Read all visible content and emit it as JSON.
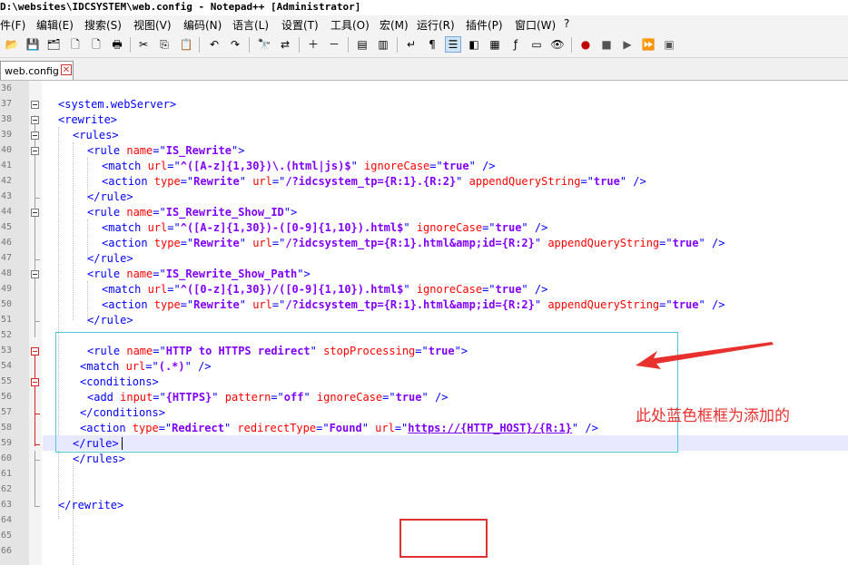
{
  "window": {
    "title": "D:\\websites\\IDCSYSTEM\\web.config - Notepad++ [Administrator]"
  },
  "menu": [
    "件(F)",
    "编辑(E)",
    "搜索(S)",
    "视图(V)",
    "编码(N)",
    "语言(L)",
    "设置(T)",
    "工具(O)",
    "宏(M)",
    "运行(R)",
    "插件(P)",
    "窗口(W)",
    "?"
  ],
  "toolbar": [
    {
      "name": "open-file-icon",
      "glyph": "📂"
    },
    {
      "name": "save-icon",
      "glyph": "💾"
    },
    {
      "name": "save-all-icon",
      "glyph": "🗂"
    },
    {
      "name": "close-file-icon",
      "glyph": "🗋"
    },
    {
      "name": "close-all-icon",
      "glyph": "🗋"
    },
    {
      "name": "print-icon",
      "glyph": "🖶"
    },
    {
      "name": "cut-icon",
      "glyph": "✂"
    },
    {
      "name": "copy-icon",
      "glyph": "⎘"
    },
    {
      "name": "paste-icon",
      "glyph": "📋"
    },
    {
      "name": "undo-icon",
      "glyph": "↶"
    },
    {
      "name": "redo-icon",
      "glyph": "↷"
    },
    {
      "name": "find-icon",
      "glyph": "🔭"
    },
    {
      "name": "replace-icon",
      "glyph": "⇄"
    },
    {
      "name": "zoom-in-icon",
      "glyph": "＋"
    },
    {
      "name": "zoom-out-icon",
      "glyph": "－"
    },
    {
      "name": "sync-vertical-icon",
      "glyph": "▤"
    },
    {
      "name": "sync-horizontal-icon",
      "glyph": "▥"
    },
    {
      "name": "word-wrap-icon",
      "glyph": "↵"
    },
    {
      "name": "show-all-chars-icon",
      "glyph": "¶"
    },
    {
      "name": "indent-guide-icon",
      "glyph": "☰"
    },
    {
      "name": "user-language-icon",
      "glyph": "◧"
    },
    {
      "name": "doc-map-icon",
      "glyph": "▦"
    },
    {
      "name": "function-list-icon",
      "glyph": "ƒ"
    },
    {
      "name": "folder-workspace-icon",
      "glyph": "▭"
    },
    {
      "name": "monitoring-icon",
      "glyph": "👁"
    },
    {
      "name": "record-macro-icon",
      "glyph": "●"
    },
    {
      "name": "stop-macro-icon",
      "glyph": "■"
    },
    {
      "name": "play-macro-icon",
      "glyph": "▶"
    },
    {
      "name": "run-macro-multiple-icon",
      "glyph": "⏩"
    },
    {
      "name": "save-macro-icon",
      "glyph": "▣"
    }
  ],
  "tab": {
    "label": "web.config",
    "close": "✕"
  },
  "editor": {
    "line_numbers": [
      "36",
      "37",
      "38",
      "39",
      "40",
      "41",
      "42",
      "43",
      "44",
      "45",
      "46",
      "47",
      "48",
      "49",
      "50",
      "51",
      "52",
      "53",
      "54",
      "55",
      "56",
      "57",
      "58",
      "59",
      "60",
      "61",
      "62",
      "63",
      "64",
      "65",
      "66"
    ],
    "lines": [
      [],
      [
        {
          "c": "t",
          "s": "<system.webServer>"
        }
      ],
      [
        {
          "c": "t",
          "s": "<rewrite>"
        }
      ],
      [
        {
          "c": "t",
          "s": "<rules>"
        }
      ],
      [
        {
          "c": "t",
          "s": "<rule "
        },
        {
          "c": "a",
          "s": "name"
        },
        {
          "c": "t",
          "s": "=\""
        },
        {
          "c": "v",
          "s": "IS_Rewrite"
        },
        {
          "c": "t",
          "s": "\">"
        }
      ],
      [
        {
          "c": "t",
          "s": "<match "
        },
        {
          "c": "a",
          "s": "url"
        },
        {
          "c": "t",
          "s": "=\""
        },
        {
          "c": "v",
          "s": "^([A-z]{1,30})\\.(html|js)$"
        },
        {
          "c": "t",
          "s": "\" "
        },
        {
          "c": "a",
          "s": "ignoreCase"
        },
        {
          "c": "t",
          "s": "=\""
        },
        {
          "c": "v",
          "s": "true"
        },
        {
          "c": "t",
          "s": "\" />"
        }
      ],
      [
        {
          "c": "t",
          "s": "<action "
        },
        {
          "c": "a",
          "s": "type"
        },
        {
          "c": "t",
          "s": "=\""
        },
        {
          "c": "v",
          "s": "Rewrite"
        },
        {
          "c": "t",
          "s": "\" "
        },
        {
          "c": "a",
          "s": "url"
        },
        {
          "c": "t",
          "s": "=\""
        },
        {
          "c": "v",
          "s": "/?idcsystem_tp={R:1}.{R:2}"
        },
        {
          "c": "t",
          "s": "\" "
        },
        {
          "c": "a",
          "s": "appendQueryString"
        },
        {
          "c": "t",
          "s": "=\""
        },
        {
          "c": "v",
          "s": "true"
        },
        {
          "c": "t",
          "s": "\" />"
        }
      ],
      [
        {
          "c": "t",
          "s": "</rule>"
        }
      ],
      [
        {
          "c": "t",
          "s": "<rule "
        },
        {
          "c": "a",
          "s": "name"
        },
        {
          "c": "t",
          "s": "=\""
        },
        {
          "c": "v",
          "s": "IS_Rewrite_Show_ID"
        },
        {
          "c": "t",
          "s": "\">"
        }
      ],
      [
        {
          "c": "t",
          "s": "<match "
        },
        {
          "c": "a",
          "s": "url"
        },
        {
          "c": "t",
          "s": "=\""
        },
        {
          "c": "v",
          "s": "^([A-z]{1,30})-([0-9]{1,10}).html$"
        },
        {
          "c": "t",
          "s": "\" "
        },
        {
          "c": "a",
          "s": "ignoreCase"
        },
        {
          "c": "t",
          "s": "=\""
        },
        {
          "c": "v",
          "s": "true"
        },
        {
          "c": "t",
          "s": "\" />"
        }
      ],
      [
        {
          "c": "t",
          "s": "<action "
        },
        {
          "c": "a",
          "s": "type"
        },
        {
          "c": "t",
          "s": "=\""
        },
        {
          "c": "v",
          "s": "Rewrite"
        },
        {
          "c": "t",
          "s": "\" "
        },
        {
          "c": "a",
          "s": "url"
        },
        {
          "c": "t",
          "s": "=\""
        },
        {
          "c": "v",
          "s": "/?idcsystem_tp={R:1}.html&amp;id={R:2}"
        },
        {
          "c": "t",
          "s": "\" "
        },
        {
          "c": "a",
          "s": "appendQueryString"
        },
        {
          "c": "t",
          "s": "=\""
        },
        {
          "c": "v",
          "s": "true"
        },
        {
          "c": "t",
          "s": "\" />"
        }
      ],
      [
        {
          "c": "t",
          "s": "</rule>"
        }
      ],
      [
        {
          "c": "t",
          "s": "<rule "
        },
        {
          "c": "a",
          "s": "name"
        },
        {
          "c": "t",
          "s": "=\""
        },
        {
          "c": "v",
          "s": "IS_Rewrite_Show_Path"
        },
        {
          "c": "t",
          "s": "\">"
        }
      ],
      [
        {
          "c": "t",
          "s": "<match "
        },
        {
          "c": "a",
          "s": "url"
        },
        {
          "c": "t",
          "s": "=\""
        },
        {
          "c": "v",
          "s": "^([0-z]{1,30})/([0-9]{1,10}).html$"
        },
        {
          "c": "t",
          "s": "\" "
        },
        {
          "c": "a",
          "s": "ignoreCase"
        },
        {
          "c": "t",
          "s": "=\""
        },
        {
          "c": "v",
          "s": "true"
        },
        {
          "c": "t",
          "s": "\" />"
        }
      ],
      [
        {
          "c": "t",
          "s": "<action "
        },
        {
          "c": "a",
          "s": "type"
        },
        {
          "c": "t",
          "s": "=\""
        },
        {
          "c": "v",
          "s": "Rewrite"
        },
        {
          "c": "t",
          "s": "\" "
        },
        {
          "c": "a",
          "s": "url"
        },
        {
          "c": "t",
          "s": "=\""
        },
        {
          "c": "v",
          "s": "/?idcsystem_tp={R:1}.html&amp;id={R:2}"
        },
        {
          "c": "t",
          "s": "\" "
        },
        {
          "c": "a",
          "s": "appendQueryString"
        },
        {
          "c": "t",
          "s": "=\""
        },
        {
          "c": "v",
          "s": "true"
        },
        {
          "c": "t",
          "s": "\" />"
        }
      ],
      [
        {
          "c": "t",
          "s": "</rule>"
        }
      ],
      [],
      [
        {
          "c": "t",
          "s": "<rule "
        },
        {
          "c": "a",
          "s": "name"
        },
        {
          "c": "t",
          "s": "=\""
        },
        {
          "c": "v",
          "s": "HTTP to HTTPS redirect"
        },
        {
          "c": "t",
          "s": "\" "
        },
        {
          "c": "a",
          "s": "stopProcessing"
        },
        {
          "c": "t",
          "s": "=\""
        },
        {
          "c": "v",
          "s": "true"
        },
        {
          "c": "t",
          "s": "\">"
        }
      ],
      [
        {
          "c": "t",
          "s": "<match "
        },
        {
          "c": "a",
          "s": "url"
        },
        {
          "c": "t",
          "s": "=\""
        },
        {
          "c": "v",
          "s": "(.*)"
        },
        {
          "c": "t",
          "s": "\" />"
        }
      ],
      [
        {
          "c": "t",
          "s": "<conditions>"
        }
      ],
      [
        {
          "c": "t",
          "s": "<add "
        },
        {
          "c": "a",
          "s": "input"
        },
        {
          "c": "t",
          "s": "=\""
        },
        {
          "c": "v",
          "s": "{HTTPS}"
        },
        {
          "c": "t",
          "s": "\" "
        },
        {
          "c": "a",
          "s": "pattern"
        },
        {
          "c": "t",
          "s": "=\""
        },
        {
          "c": "v",
          "s": "off"
        },
        {
          "c": "t",
          "s": "\" "
        },
        {
          "c": "a",
          "s": "ignoreCase"
        },
        {
          "c": "t",
          "s": "=\""
        },
        {
          "c": "v",
          "s": "true"
        },
        {
          "c": "t",
          "s": "\" />"
        }
      ],
      [
        {
          "c": "t",
          "s": "</conditions>"
        }
      ],
      [
        {
          "c": "t",
          "s": "<action "
        },
        {
          "c": "a",
          "s": "type"
        },
        {
          "c": "t",
          "s": "=\""
        },
        {
          "c": "v",
          "s": "Redirect"
        },
        {
          "c": "t",
          "s": "\" "
        },
        {
          "c": "a",
          "s": "redirectType"
        },
        {
          "c": "t",
          "s": "=\""
        },
        {
          "c": "v",
          "s": "Found"
        },
        {
          "c": "t",
          "s": "\" "
        },
        {
          "c": "a",
          "s": "url"
        },
        {
          "c": "t",
          "s": "=\""
        },
        {
          "c": "u",
          "s": "https://{HTTP_HOST}/{R:1}"
        },
        {
          "c": "t",
          "s": "\" />"
        }
      ],
      [
        {
          "c": "t",
          "s": "</rule>"
        }
      ],
      [
        {
          "c": "t",
          "s": "</rules>"
        }
      ],
      [],
      [],
      [
        {
          "c": "t",
          "s": "</rewrite>"
        }
      ],
      [],
      [],
      []
    ]
  },
  "annotation": {
    "text": "此处蓝色框框为添加的"
  },
  "colors": {
    "tag": "#0000ff",
    "attribute": "#ff0000",
    "value": "#8000ff",
    "annotation": "#e8312f",
    "cyan_box": "#48c8d8",
    "red_box": "#e03030"
  }
}
